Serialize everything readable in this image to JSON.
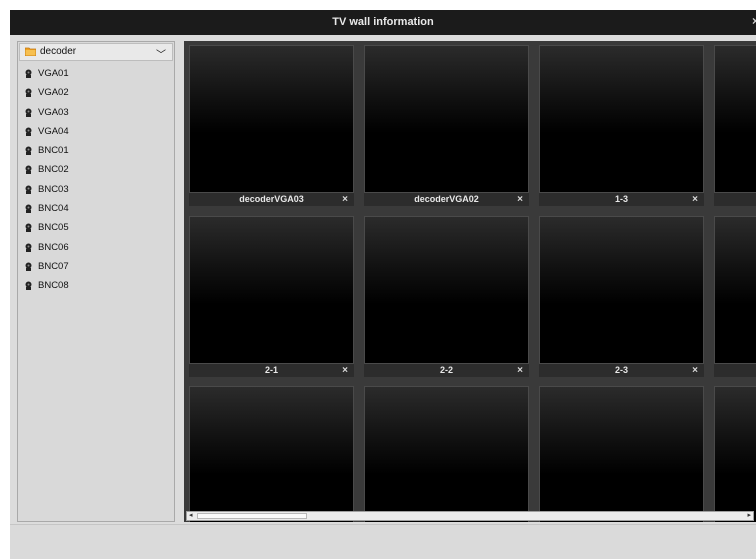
{
  "window": {
    "title": "TV wall information",
    "close_glyph": "×"
  },
  "sidebar": {
    "device": {
      "label": "decoder",
      "icon": "folder-icon",
      "chevron": "﹀"
    },
    "channels": [
      "VGA01",
      "VGA02",
      "VGA03",
      "VGA04",
      "BNC01",
      "BNC02",
      "BNC03",
      "BNC04",
      "BNC05",
      "BNC06",
      "BNC07",
      "BNC08"
    ]
  },
  "wall": {
    "close_glyph": "×",
    "row1": [
      "decoderVGA03",
      "decoderVGA02",
      "1-3"
    ],
    "row2": [
      "2-1",
      "2-2",
      "2-3"
    ]
  },
  "scrollbar": {
    "left_glyph": "◂",
    "right_glyph": "▸"
  },
  "colors": {
    "titlebar": "#1b1b1b",
    "wall_bg": "#3a3a3a",
    "panel": "#dcdcdc"
  }
}
